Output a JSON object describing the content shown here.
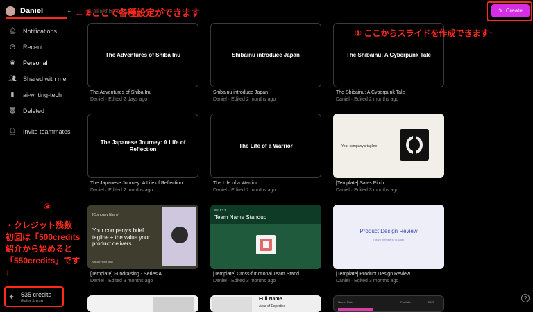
{
  "user": {
    "name": "Daniel"
  },
  "nav": [
    {
      "label": "Notifications",
      "icon": "bell-icon"
    },
    {
      "label": "Recent",
      "icon": "clock-icon"
    },
    {
      "label": "Personal",
      "icon": "person-icon"
    },
    {
      "label": "Shared with me",
      "icon": "users-icon"
    },
    {
      "label": "ai-writing-tech",
      "icon": "chart-icon"
    },
    {
      "label": "Deleted",
      "icon": "trash-icon"
    },
    {
      "label": "Invite teammates",
      "icon": "add-user-icon"
    }
  ],
  "credits": {
    "amount": "635 credits",
    "sub": "Refer & earn"
  },
  "header": {
    "create_label": "Create",
    "partially_hidden": "Created by Daniel"
  },
  "cards": [
    {
      "title": "The Adventures of Shiba Inu",
      "meta": "Daniel · Edited 2 days ago",
      "thumb_text": "The Adventures of Shiba Inu"
    },
    {
      "title": "Shibainu introduce Japan",
      "meta": "Daniel · Edited 2 months ago",
      "thumb_text": "Shibainu introduce Japan"
    },
    {
      "title": "The Shibainu: A Cyberpunk Tale",
      "meta": "Daniel · Edited 2 months ago",
      "thumb_text": "The Shibainu: A Cyberpunk Tale"
    },
    {
      "title": "The Japanese Journey: A Life of Reflection",
      "meta": "Daniel · Edited 2 months ago",
      "thumb_text": "The Japanese Journey: A Life of Reflection"
    },
    {
      "title": "The Life of a Warrior",
      "meta": "Daniel · Edited 2 months ago",
      "thumb_text": "The Life of a Warrior"
    },
    {
      "title": "[Template] Sales Pitch",
      "meta": "Daniel · Edited 3 months ago",
      "thumb_text": "Your company's tagline"
    },
    {
      "title": "[Template] Fundraising - Series A",
      "meta": "Daniel · Edited 3 months ago",
      "thumb_company": "[Company Name]",
      "thumb_brief": "Your company's brief tagline + the value your product delivers",
      "thumb_visual": "Visual: Your logo"
    },
    {
      "title": "[Template] Cross-functional Team Stand...",
      "meta": "Daniel · Edited 3 months ago",
      "thumb_date": "M/D/YY",
      "thumb_name": "Team Name Standup"
    },
    {
      "title": "[Template] Product Design Review",
      "meta": "Daniel · Edited 3 months ago",
      "thumb_heading": "Product Design Review",
      "thumb_sub": "[Team members] • [Date]"
    }
  ],
  "row4": {
    "b_name": "Full Name",
    "b_sub": "Area of Expertise",
    "c_name": "Name, Role",
    "c_portfolio": "Portfolio",
    "c_year": "2023"
  },
  "annotations": {
    "a1": "←②ここで各種設定ができます",
    "a2": "① ここからスライドを作成できます↑",
    "a3": "③",
    "lines": [
      "・クレジット残数",
      "初回は「500credits",
      "紹介から始めると",
      "「550credits」です",
      "↓"
    ]
  },
  "colors": {
    "accent": "#d62ee6",
    "annotation": "#ff2a1a"
  }
}
